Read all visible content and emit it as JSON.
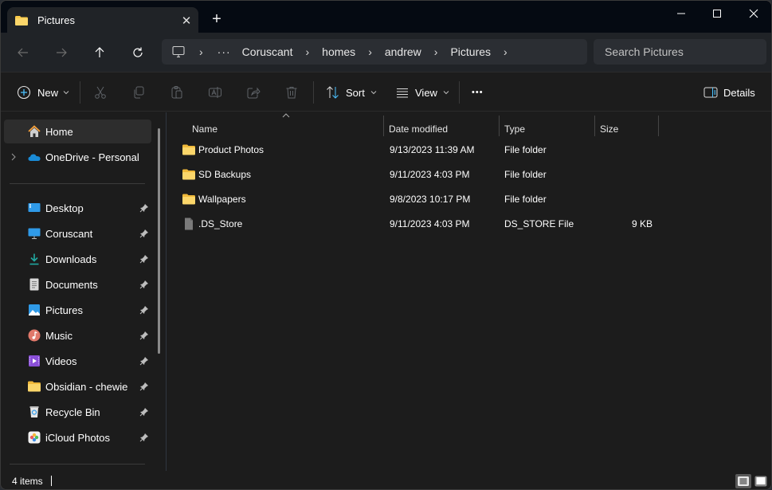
{
  "window": {
    "tab_title": "Pictures",
    "tab_icon": "folder-icon",
    "new_tab_label": "+",
    "controls": [
      "minimize",
      "maximize",
      "close"
    ]
  },
  "navigation": {
    "back": "back-arrow-icon",
    "forward": "forward-arrow-icon",
    "up": "up-arrow-icon",
    "refresh": "refresh-icon",
    "address": {
      "root_icon": "computer-icon",
      "overflow": "···",
      "breadcrumbs": [
        "Coruscant",
        "homes",
        "andrew",
        "Pictures"
      ]
    },
    "search_placeholder": "Search Pictures"
  },
  "commandbar": {
    "new_label": "New",
    "sort_label": "Sort",
    "view_label": "View",
    "more_label": "•••",
    "details_label": "Details",
    "disabled_actions": [
      "cut",
      "copy",
      "paste",
      "rename",
      "share",
      "delete"
    ]
  },
  "sidebar": {
    "top": [
      {
        "label": "Home",
        "icon": "home-icon",
        "selected": true
      },
      {
        "label": "OneDrive - Personal",
        "icon": "onedrive-icon",
        "expandable": true
      }
    ],
    "quick_access": [
      {
        "label": "Desktop",
        "icon": "desktop-icon",
        "pinned": true
      },
      {
        "label": "Coruscant",
        "icon": "monitor-icon",
        "pinned": true
      },
      {
        "label": "Downloads",
        "icon": "download-icon",
        "pinned": true
      },
      {
        "label": "Documents",
        "icon": "document-icon",
        "pinned": true
      },
      {
        "label": "Pictures",
        "icon": "pictures-icon",
        "pinned": true
      },
      {
        "label": "Music",
        "icon": "music-icon",
        "pinned": true
      },
      {
        "label": "Videos",
        "icon": "videos-icon",
        "pinned": true
      },
      {
        "label": "Obsidian - chewie",
        "icon": "folder-icon",
        "pinned": true
      },
      {
        "label": "Recycle Bin",
        "icon": "recycle-bin-icon",
        "pinned": true
      },
      {
        "label": "iCloud Photos",
        "icon": "icloud-photos-icon",
        "pinned": true
      }
    ]
  },
  "filelist": {
    "columns": [
      "Name",
      "Date modified",
      "Type",
      "Size"
    ],
    "sorted_by": "Name",
    "rows": [
      {
        "name": "Product Photos",
        "date": "9/13/2023 11:39 AM",
        "type": "File folder",
        "size": "",
        "icon": "folder-icon"
      },
      {
        "name": "SD Backups",
        "date": "9/11/2023 4:03 PM",
        "type": "File folder",
        "size": "",
        "icon": "folder-icon"
      },
      {
        "name": "Wallpapers",
        "date": "9/8/2023 10:17 PM",
        "type": "File folder",
        "size": "",
        "icon": "folder-icon"
      },
      {
        "name": ".DS_Store",
        "date": "9/11/2023 4:03 PM",
        "type": "DS_STORE File",
        "size": "9 KB",
        "icon": "file-icon"
      }
    ]
  },
  "status": {
    "item_count": "4 items",
    "view_modes": [
      "details-view",
      "large-icons-view"
    ],
    "active_view": "details-view"
  },
  "colors": {
    "accent": "#4cc2ff",
    "folder": "#f8c94a",
    "background": "#1c1c1c",
    "titlebar": "#050a12"
  }
}
